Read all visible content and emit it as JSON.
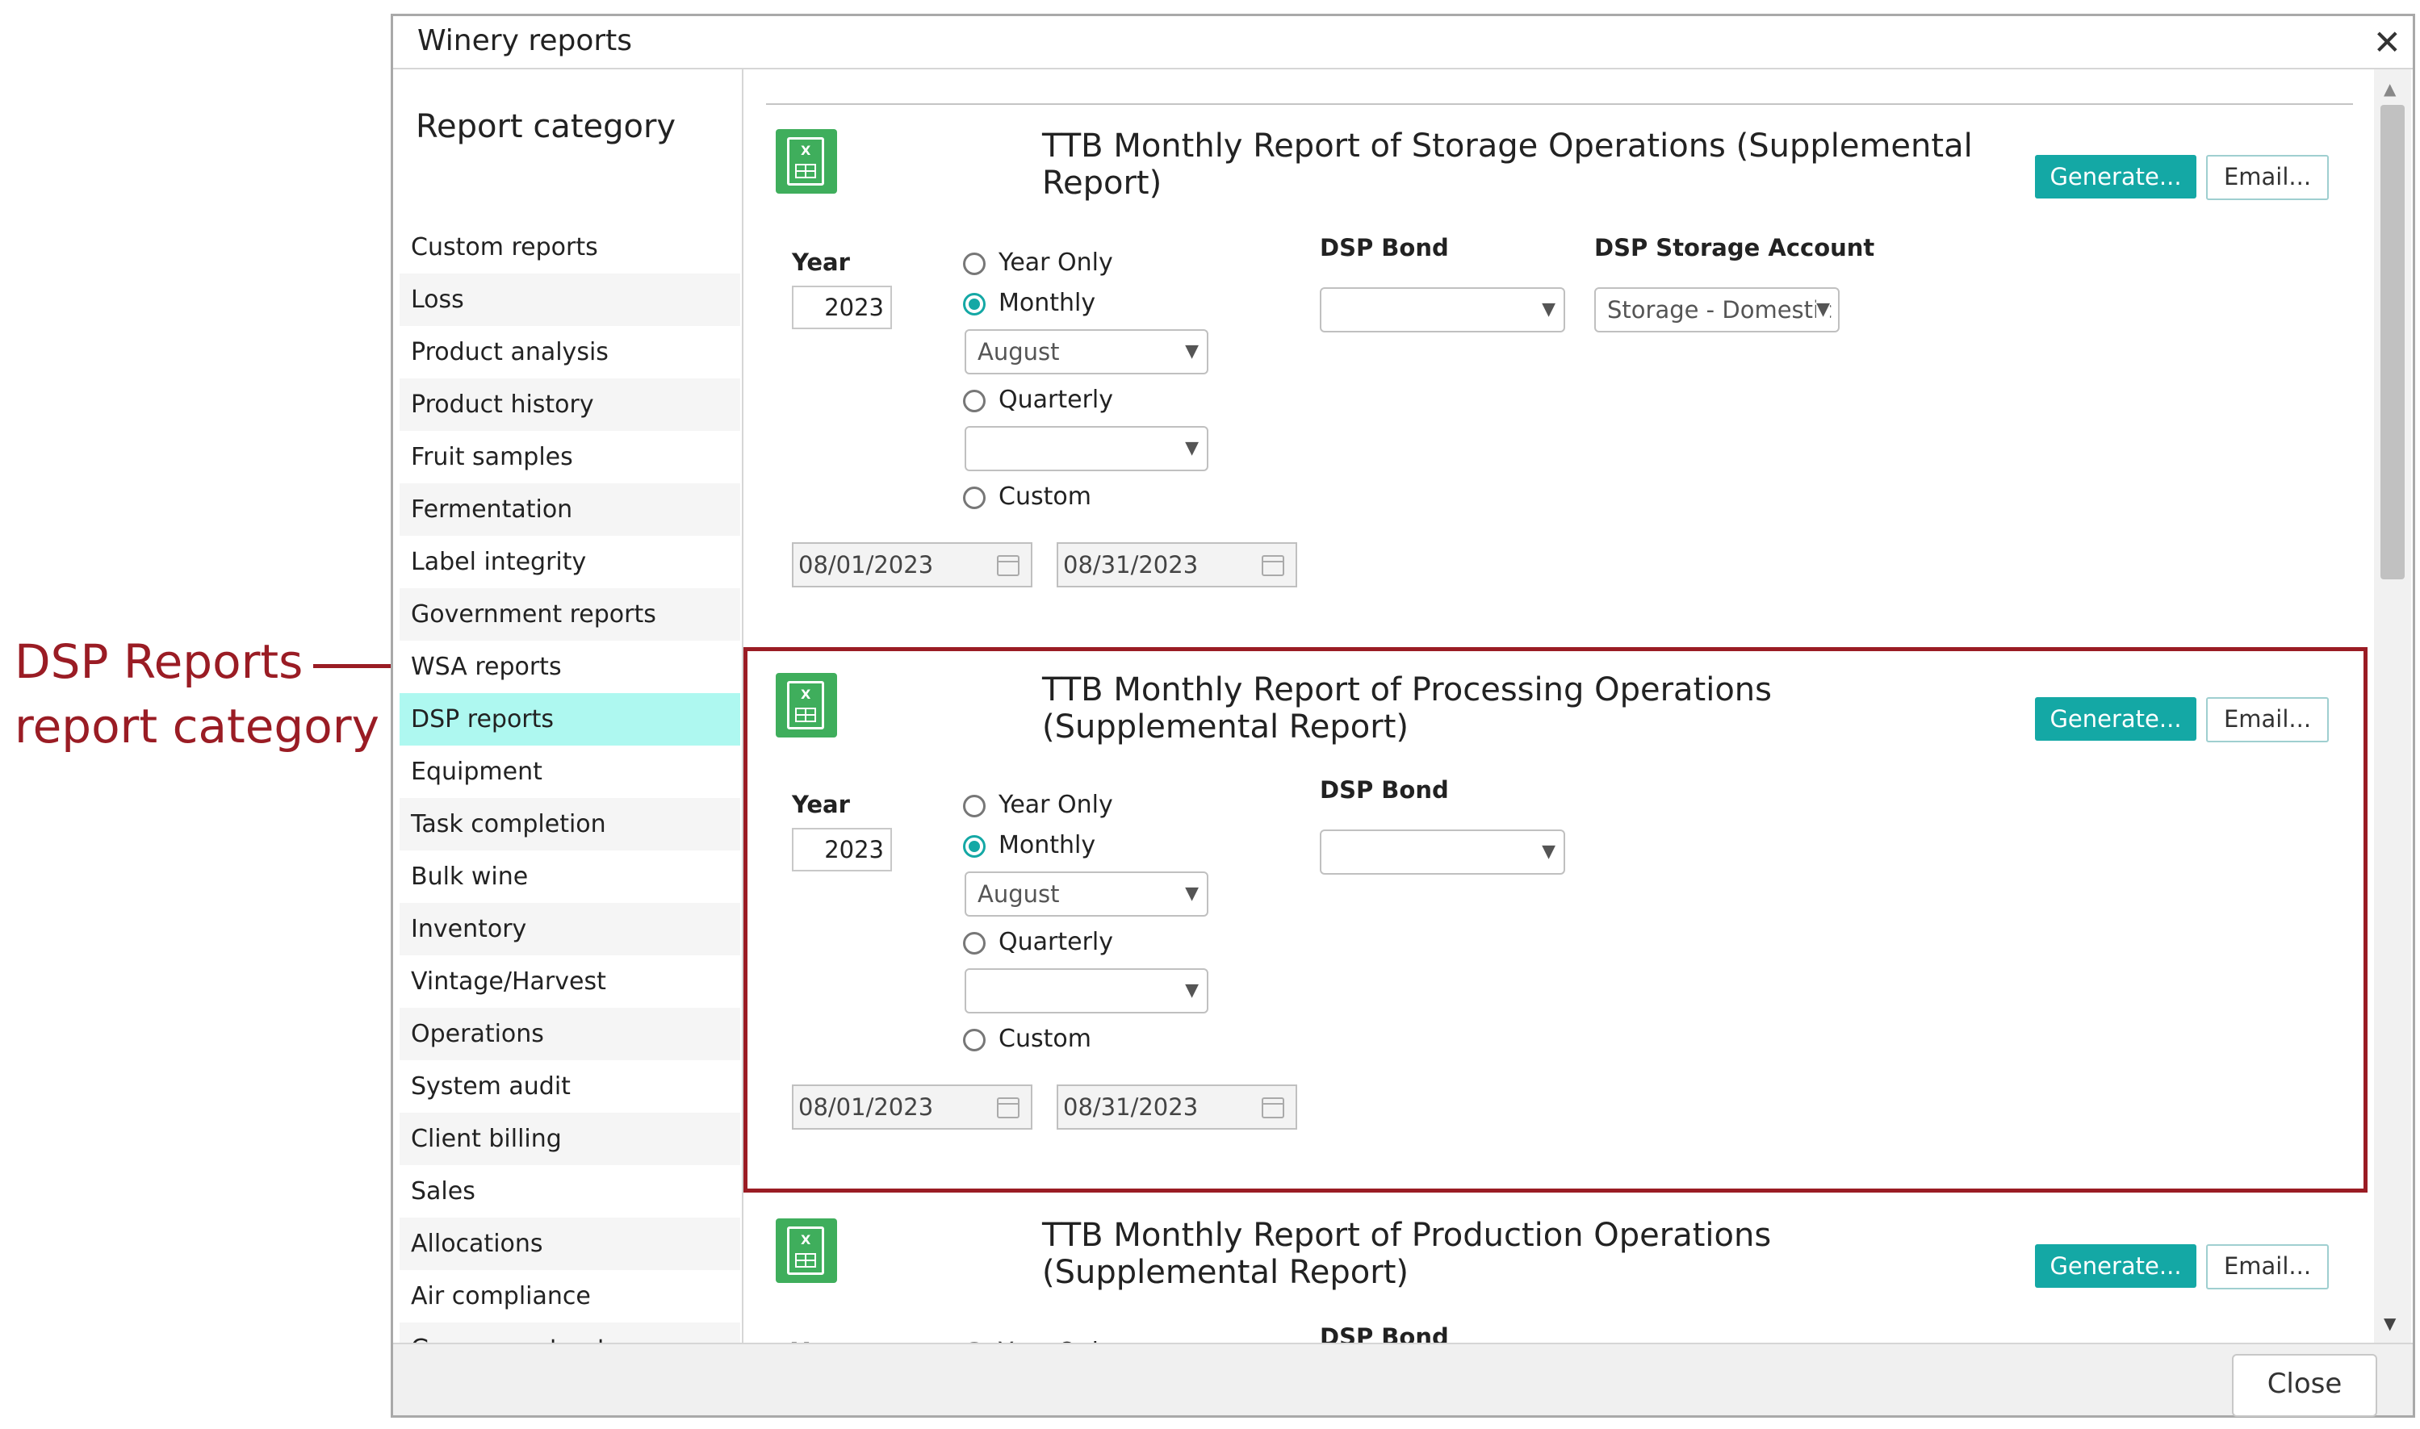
{
  "callout": {
    "line1": "DSP Reports",
    "line2": "report category"
  },
  "dialog": {
    "title": "Winery reports",
    "close_label": "Close"
  },
  "sidebar": {
    "heading": "Report category",
    "items": [
      {
        "label": "Custom reports"
      },
      {
        "label": "Loss"
      },
      {
        "label": "Product analysis"
      },
      {
        "label": "Product history"
      },
      {
        "label": "Fruit samples"
      },
      {
        "label": "Fermentation"
      },
      {
        "label": "Label integrity"
      },
      {
        "label": "Government reports"
      },
      {
        "label": "WSA reports"
      },
      {
        "label": "DSP reports",
        "active": true
      },
      {
        "label": "Equipment"
      },
      {
        "label": "Task completion"
      },
      {
        "label": "Bulk wine"
      },
      {
        "label": "Inventory"
      },
      {
        "label": "Vintage/Harvest"
      },
      {
        "label": "Operations"
      },
      {
        "label": "System audit"
      },
      {
        "label": "Client billing"
      },
      {
        "label": "Sales"
      },
      {
        "label": "Allocations"
      },
      {
        "label": "Air compliance"
      },
      {
        "label": "Grower contracts"
      }
    ]
  },
  "common": {
    "generate_label": "Generate...",
    "email_label": "Email...",
    "year_label": "Year",
    "year_value": "2023",
    "opt_year_only": "Year Only",
    "opt_monthly": "Monthly",
    "opt_quarterly": "Quarterly",
    "opt_custom": "Custom",
    "month_value": "August",
    "quarter_value": "",
    "start_date": "08/01/2023",
    "end_date": "08/31/2023",
    "dsp_bond_label": "DSP Bond",
    "dsp_bond_value": ""
  },
  "reports": [
    {
      "title": "TTB Monthly Report of Storage Operations (Supplemental Report)",
      "storage_account_label": "DSP Storage Account",
      "storage_account_value": "Storage - Domestic",
      "selected_period": "monthly"
    },
    {
      "title": "TTB Monthly Report of Processing Operations (Supplemental Report)",
      "selected_period": "monthly",
      "highlighted": true
    },
    {
      "title": "TTB Monthly Report of Production Operations (Supplemental Report)",
      "selected_period": "monthly"
    }
  ],
  "colors": {
    "accent": "#14a8a5",
    "highlight": "#9a1c24",
    "active_item": "#aef8f0",
    "excel_icon": "#3fae5c"
  }
}
